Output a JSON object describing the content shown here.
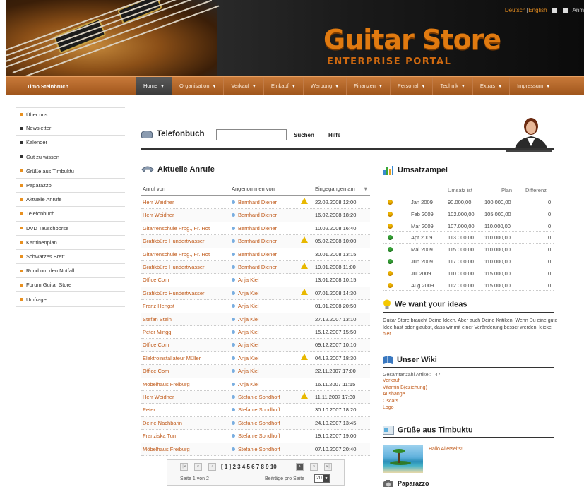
{
  "header": {
    "logo_main": "Guitar Store",
    "logo_sub": "ENTERPRISE PORTAL",
    "lang_de": "Deutsch",
    "lang_en": "English",
    "login_label": "Anm"
  },
  "nav": {
    "username": "Timo Steinbruch",
    "items": [
      {
        "label": "Home"
      },
      {
        "label": "Organisation"
      },
      {
        "label": "Verkauf"
      },
      {
        "label": "Einkauf"
      },
      {
        "label": "Werbung"
      },
      {
        "label": "Finanzen"
      },
      {
        "label": "Personal"
      },
      {
        "label": "Technik"
      },
      {
        "label": "Extras"
      },
      {
        "label": "Impressum"
      }
    ]
  },
  "sidebar": {
    "items": [
      {
        "label": "Über uns",
        "bullet": "#e89020"
      },
      {
        "label": "Newsletter",
        "bullet": "#333333"
      },
      {
        "label": "Kalender",
        "bullet": "#333333"
      },
      {
        "label": "Gut zu wissen",
        "bullet": "#333333"
      },
      {
        "label": "Grüße aus Timbuktu",
        "bullet": "#e89020"
      },
      {
        "label": "Paparazzo",
        "bullet": "#e89020"
      },
      {
        "label": "Aktuelle Anrufe",
        "bullet": "#e89020"
      },
      {
        "label": "Telefonbuch",
        "bullet": "#e89020"
      },
      {
        "label": "DVD Tauschbörse",
        "bullet": "#e89020"
      },
      {
        "label": "Kantinenplan",
        "bullet": "#e89020"
      },
      {
        "label": "Schwarzes Brett",
        "bullet": "#e89020"
      },
      {
        "label": "Rund um den Notfall",
        "bullet": "#e89020"
      },
      {
        "label": "Forum Guitar Store",
        "bullet": "#e89020"
      },
      {
        "label": "Umfrage",
        "bullet": "#e89020"
      }
    ]
  },
  "phonebook": {
    "title": "Telefonbuch",
    "search_value": "",
    "search_label": "Suchen",
    "help_label": "Hilfe"
  },
  "calls": {
    "title": "Aktuelle Anrufe",
    "col_from": "Anruf von",
    "col_by": "Angenommen von",
    "col_date": "Eingegangen am",
    "rows": [
      {
        "from": "Herr Weidner",
        "by": "Bernhard Diener",
        "warn": true,
        "date": "22.02.2008 12:00"
      },
      {
        "from": "Herr Weidner",
        "by": "Bernhard Diener",
        "warn": false,
        "date": "16.02.2008 18:20"
      },
      {
        "from": "Gitarrenschule Frbg., Fr. Rot",
        "by": "Bernhard Diener",
        "warn": false,
        "date": "10.02.2008 16:40"
      },
      {
        "from": "Grafikbüro Hundertwasser",
        "by": "Bernhard Diener",
        "warn": true,
        "date": "05.02.2008 10:00"
      },
      {
        "from": "Gitarrenschule Frbg., Fr. Rot",
        "by": "Bernhard Diener",
        "warn": false,
        "date": "30.01.2008 13:15"
      },
      {
        "from": "Grafikbüro Hundertwasser",
        "by": "Bernhard Diener",
        "warn": true,
        "date": "19.01.2008 11:00"
      },
      {
        "from": "Office Com",
        "by": "Anja Kiel",
        "warn": false,
        "date": "13.01.2008 10:15"
      },
      {
        "from": "Grafikbüro Hundertwasser",
        "by": "Anja Kiel",
        "warn": true,
        "date": "07.01.2008 14:30"
      },
      {
        "from": "Franz Hengst",
        "by": "Anja Kiel",
        "warn": false,
        "date": "01.01.2008 20:50"
      },
      {
        "from": "Stefan Stein",
        "by": "Anja Kiel",
        "warn": false,
        "date": "27.12.2007 13:10"
      },
      {
        "from": "Peter Mingg",
        "by": "Anja Kiel",
        "warn": false,
        "date": "15.12.2007 15:50"
      },
      {
        "from": "Office Com",
        "by": "Anja Kiel",
        "warn": false,
        "date": "09.12.2007 10:10"
      },
      {
        "from": "Elektroinstallateur Müller",
        "by": "Anja Kiel",
        "warn": true,
        "date": "04.12.2007 18:30"
      },
      {
        "from": "Office Com",
        "by": "Anja Kiel",
        "warn": false,
        "date": "22.11.2007 17:00"
      },
      {
        "from": "Möbelhaus Freiburg",
        "by": "Anja Kiel",
        "warn": false,
        "date": "16.11.2007 11:15"
      },
      {
        "from": "Herr Weidner",
        "by": "Stefanie Sondhoff",
        "warn": true,
        "date": "11.11.2007 17:30"
      },
      {
        "from": "Peter",
        "by": "Stefanie Sondhoff",
        "warn": false,
        "date": "30.10.2007 18:20"
      },
      {
        "from": "Deine Nachbarin",
        "by": "Stefanie Sondhoff",
        "warn": false,
        "date": "24.10.2007 13:45"
      },
      {
        "from": "Franziska Tun",
        "by": "Stefanie Sondhoff",
        "warn": false,
        "date": "19.10.2007 19:00"
      },
      {
        "from": "Möbelhaus Freiburg",
        "by": "Stefanie Sondhoff",
        "warn": false,
        "date": "07.10.2007 20:40"
      }
    ],
    "pager": {
      "pages": "[ 1 ]  2 3 4 5 6 7 8 9 10",
      "page_info": "Seite 1 von 2",
      "per_page_label": "Beiträge pro Seite",
      "per_page_value": "20"
    }
  },
  "sales": {
    "title": "Umsatzampel",
    "col_actual": "Umsatz ist",
    "col_plan": "Plan",
    "col_diff": "Differenz",
    "rows": [
      {
        "status": "y",
        "month": "Jan 2009",
        "actual": "90.000,00",
        "plan": "100.000,00",
        "diff": "0"
      },
      {
        "status": "y",
        "month": "Feb 2009",
        "actual": "102.000,00",
        "plan": "105.000,00",
        "diff": "0"
      },
      {
        "status": "y",
        "month": "Mar 2009",
        "actual": "107.000,00",
        "plan": "110.000,00",
        "diff": "0"
      },
      {
        "status": "g",
        "month": "Apr 2009",
        "actual": "113.000,00",
        "plan": "110.000,00",
        "diff": "0"
      },
      {
        "status": "g",
        "month": "Mai 2009",
        "actual": "115.000,00",
        "plan": "110.000,00",
        "diff": "0"
      },
      {
        "status": "g",
        "month": "Jun 2009",
        "actual": "117.000,00",
        "plan": "110.000,00",
        "diff": "0"
      },
      {
        "status": "y",
        "month": "Jul 2009",
        "actual": "110.000,00",
        "plan": "115.000,00",
        "diff": "0"
      },
      {
        "status": "y",
        "month": "Aug 2009",
        "actual": "112.000,00",
        "plan": "115.000,00",
        "diff": "0"
      }
    ],
    "colors": {
      "yellow": "#f0b800",
      "green": "#3aa83a"
    }
  },
  "ideas": {
    "title": "We want your ideas",
    "text": "Guitar Store braucht Deine Ideen. Aber auch Deine Kritiken. Wenn Du eine gute Idee hast oder glaubst, dass wir mit einer Veränderung besser werden, klicke",
    "link": "hier ..."
  },
  "wiki": {
    "title": "Unser Wiki",
    "count_label": "Gesamtanzahl Artikel:",
    "count": "47",
    "links": [
      "Verkauf",
      "Vitamin B(eziehung)",
      "Aushänge",
      "Oscars",
      "Logo"
    ]
  },
  "greetings": {
    "title": "Grüße aus Timbuktu",
    "link": "Hallo Allerseits!"
  },
  "paparazzo": {
    "title": "Paparazzo"
  },
  "colors": {
    "accent": "#c05a1a",
    "nav": "#b8692a",
    "logo": "#e07a10"
  }
}
